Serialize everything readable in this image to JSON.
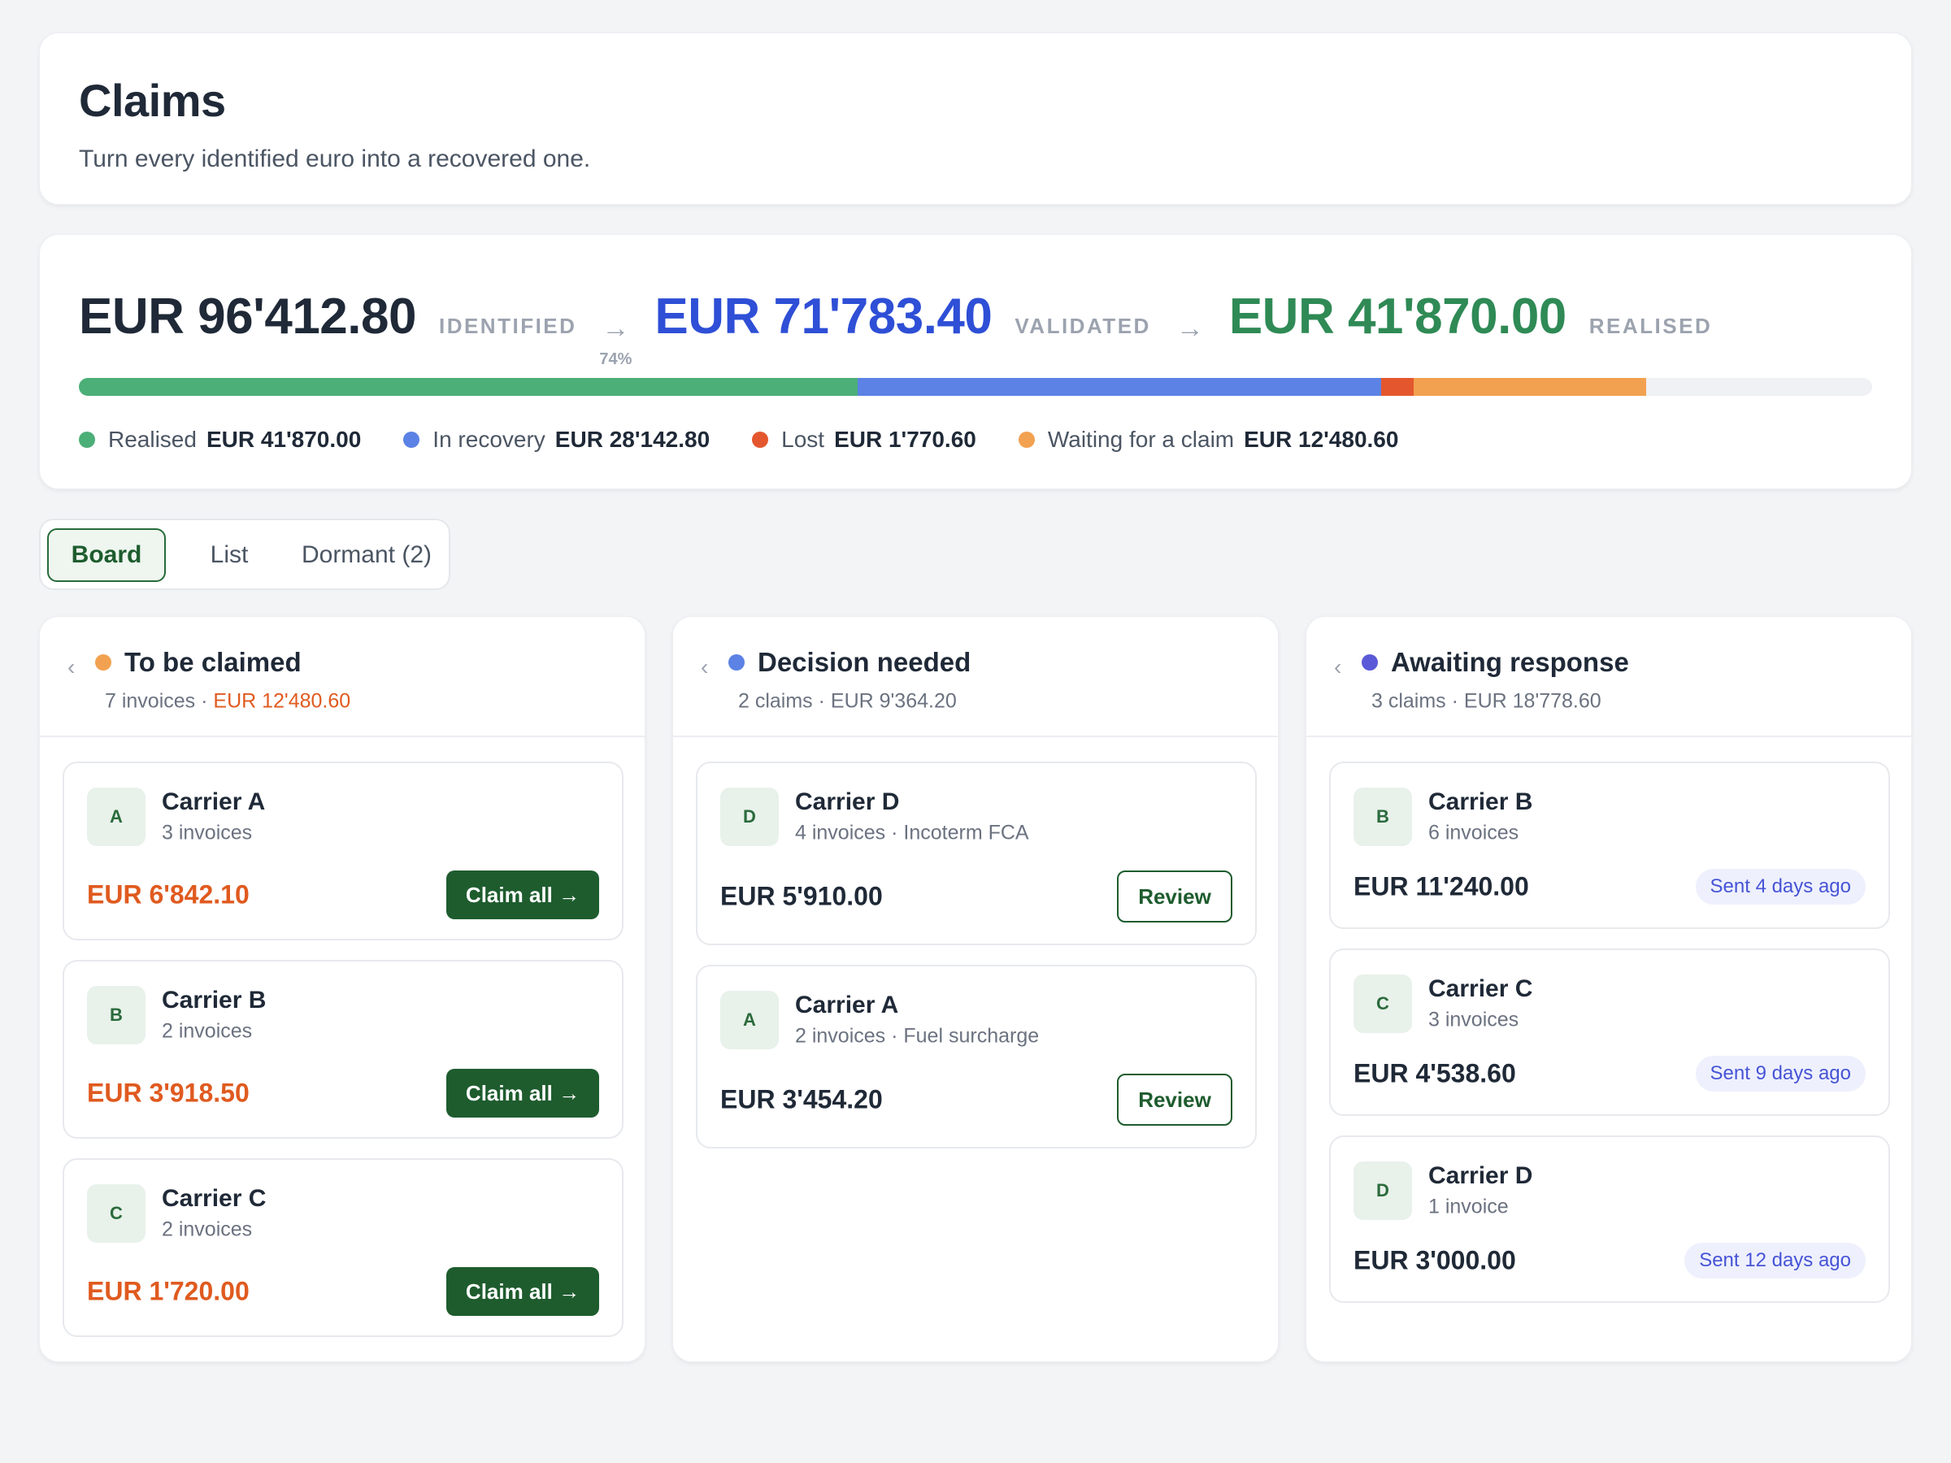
{
  "header": {
    "title": "Claims",
    "subtitle": "Turn every identified euro into a recovered one."
  },
  "summary": {
    "identified": {
      "amount": "EUR 96'412.80",
      "label": "IDENTIFIED"
    },
    "arrow": "→",
    "conversion_pct": "74%",
    "validated": {
      "amount": "EUR 71'783.40",
      "label": "VALIDATED"
    },
    "realised": {
      "amount": "EUR 41'870.00",
      "label": "REALISED"
    },
    "progress_total": 96412.8,
    "segments": [
      {
        "name": "Realised",
        "value": 41870.0,
        "display": "EUR 41'870.00",
        "color": "#4caf78"
      },
      {
        "name": "In recovery",
        "value": 28142.8,
        "display": "EUR 28'142.80",
        "color": "#5b82e4"
      },
      {
        "name": "Lost",
        "value": 1770.6,
        "display": "EUR 1'770.60",
        "color": "#e4572e"
      },
      {
        "name": "Waiting for a claim",
        "value": 12480.6,
        "display": "EUR 12'480.60",
        "color": "#f2a150"
      }
    ]
  },
  "tabs": [
    {
      "label": "Board",
      "active": true
    },
    {
      "label": "List",
      "active": false
    },
    {
      "label": "Dormant (2)",
      "active": false
    }
  ],
  "columns": {
    "to_be_claimed": {
      "chevron": "‹",
      "title": "To be claimed",
      "dot_color": "#f2a150",
      "sub_count": "7 invoices · ",
      "sub_amount": "EUR 12'480.60",
      "button_label": "Claim all →",
      "cards": [
        {
          "initial": "A",
          "carrier": "Carrier A",
          "meta": "3 invoices",
          "amount": "EUR 6'842.10"
        },
        {
          "initial": "B",
          "carrier": "Carrier B",
          "meta": "2 invoices",
          "amount": "EUR 3'918.50"
        },
        {
          "initial": "C",
          "carrier": "Carrier C",
          "meta": "2 invoices",
          "amount": "EUR 1'720.00"
        }
      ]
    },
    "decision_needed": {
      "chevron": "‹",
      "title": "Decision needed",
      "dot_color": "#5b82e4",
      "sub": "2 claims · EUR 9'364.20",
      "button_label": "Review",
      "cards": [
        {
          "initial": "D",
          "carrier": "Carrier D",
          "meta": "4 invoices · Incoterm FCA",
          "amount": "EUR 5'910.00"
        },
        {
          "initial": "A",
          "carrier": "Carrier A",
          "meta": "2 invoices · Fuel surcharge",
          "amount": "EUR 3'454.20"
        }
      ]
    },
    "awaiting_response": {
      "chevron": "‹",
      "title": "Awaiting response",
      "dot_color": "#5a5ad8",
      "sub": "3 claims · EUR 18'778.60",
      "cards": [
        {
          "initial": "B",
          "carrier": "Carrier B",
          "meta": "6 invoices",
          "amount": "EUR 11'240.00",
          "status": "Sent 4 days ago"
        },
        {
          "initial": "C",
          "carrier": "Carrier C",
          "meta": "3 invoices",
          "amount": "EUR 4'538.60",
          "status": "Sent 9 days ago"
        },
        {
          "initial": "D",
          "carrier": "Carrier D",
          "meta": "1 invoice",
          "amount": "EUR 3'000.00",
          "status": "Sent 12 days ago"
        }
      ]
    }
  }
}
